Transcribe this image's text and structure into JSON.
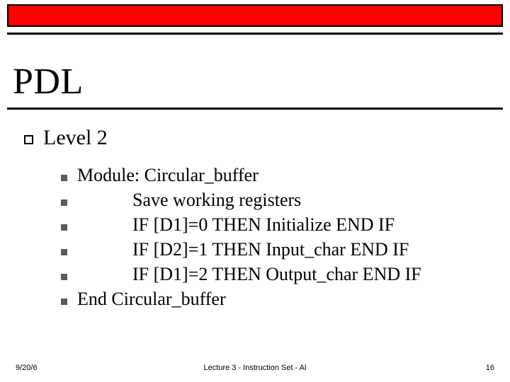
{
  "title": "PDL",
  "level1": "Level 2",
  "bullets": [
    "Module: Circular_buffer",
    "            Save working registers",
    "            IF [D1]=0 THEN Initialize END IF",
    "            IF [D2]=1 THEN Input_char END IF",
    "            IF [D1]=2 THEN Output_char END IF",
    "End Circular_buffer"
  ],
  "footer": {
    "date": "9/20/6",
    "center": "Lecture 3 - Instruction Set - Al",
    "page": "16"
  }
}
